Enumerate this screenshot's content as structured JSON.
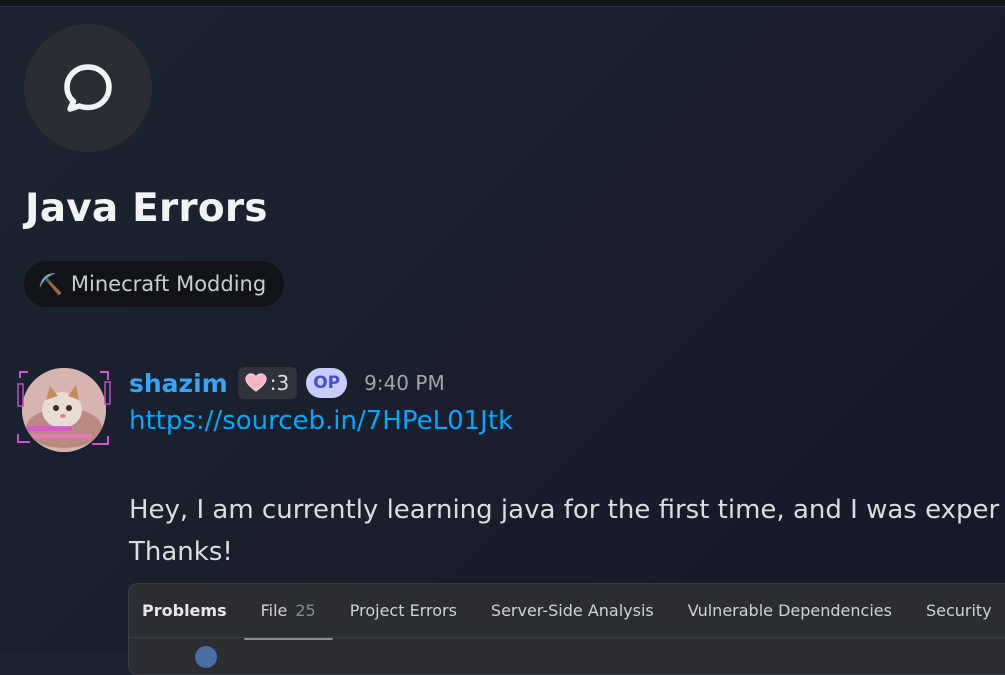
{
  "thread": {
    "icon": "chat-bubble-icon",
    "title": "Java Errors",
    "tag": {
      "icon": "pickaxe-icon",
      "glyph": "⛏️",
      "label": "Minecraft Modding"
    }
  },
  "message": {
    "author": "shazim",
    "role_tag": {
      "icon": "pink-heart-icon",
      "text": ":3"
    },
    "op_badge": "OP",
    "timestamp": "9:40 PM",
    "link": "https://sourceb.in/7HPeL01Jtk",
    "body_lines": [
      "Hey, I am currently learning java for the first time, and I was exper",
      "Thanks!"
    ]
  },
  "attachment": {
    "tabs": [
      {
        "label": "Problems"
      },
      {
        "label": "File",
        "count": "25"
      },
      {
        "label": "Project Errors"
      },
      {
        "label": "Server-Side Analysis"
      },
      {
        "label": "Vulnerable Dependencies"
      },
      {
        "label": "Security"
      }
    ]
  },
  "colors": {
    "username": "#3aa3f2",
    "link": "#00a8fc",
    "op_badge_bg": "#c9cdfb",
    "op_badge_text": "#4752c4"
  }
}
